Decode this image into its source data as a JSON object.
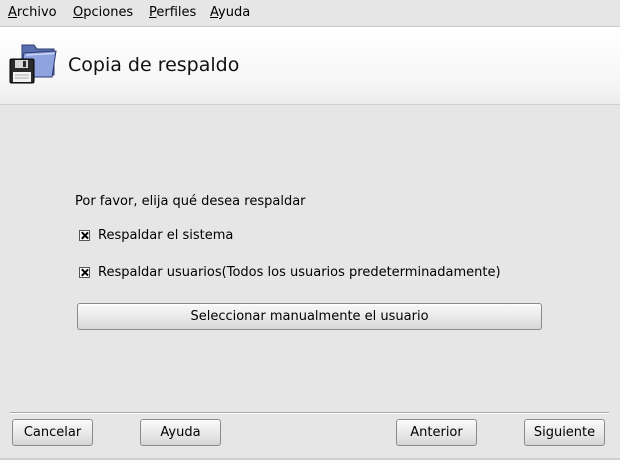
{
  "menubar": {
    "items": [
      {
        "label": "Archivo",
        "mnemonic": "A",
        "rest": "rchivo"
      },
      {
        "label": "Opciones",
        "mnemonic": "O",
        "rest": "pciones"
      },
      {
        "label": "Perfiles",
        "mnemonic": "P",
        "rest": "erfiles"
      },
      {
        "label": "Ayuda",
        "mnemonic": "A",
        "rest": "yuda"
      }
    ]
  },
  "header": {
    "title": "Copia de respaldo",
    "icon": "backup-floppy-folder-icon"
  },
  "main": {
    "instruction": "Por favor, elija qué desea respaldar",
    "options": [
      {
        "label": "Respaldar el sistema",
        "checked": true
      },
      {
        "label": "Respaldar usuarios(Todos los usuarios predeterminadamente)",
        "checked": true
      }
    ],
    "select_users_button": "Seleccionar manualmente el usuario"
  },
  "footer": {
    "cancel": "Cancelar",
    "help": "Ayuda",
    "previous": "Anterior",
    "next": "Siguiente"
  }
}
